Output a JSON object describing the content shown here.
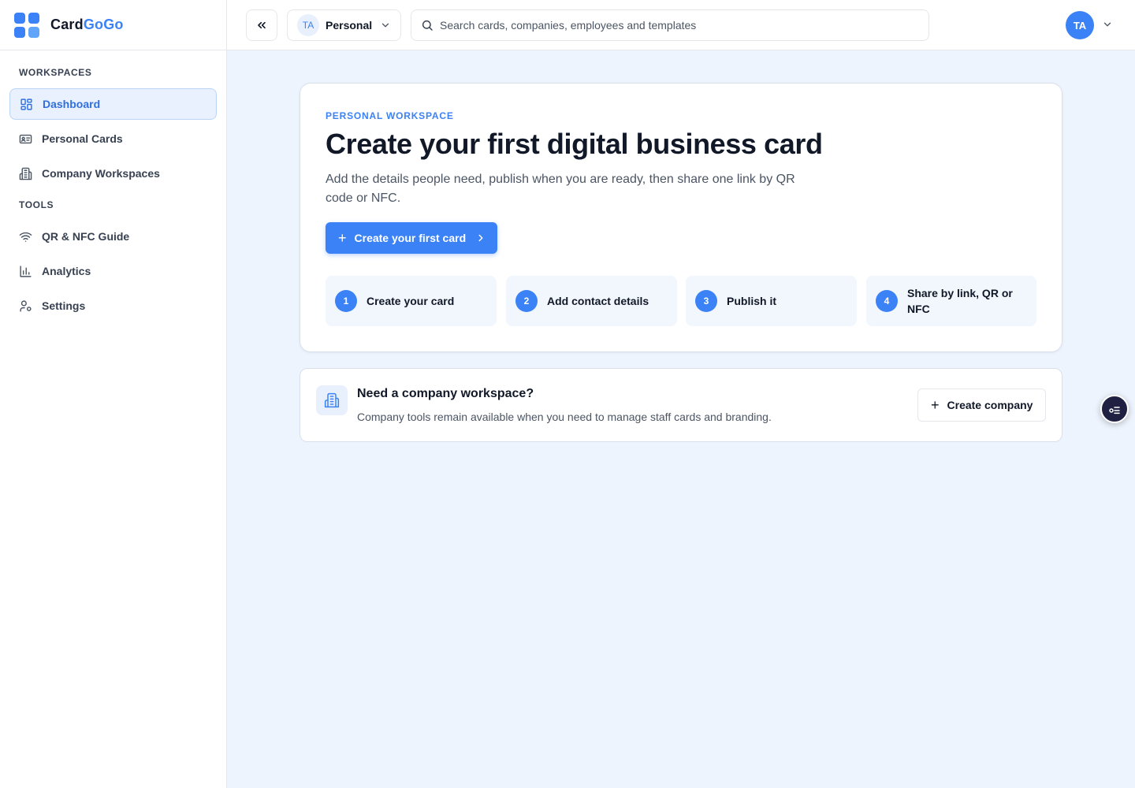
{
  "brand": {
    "name_part1": "Card",
    "name_part2": "GoGo"
  },
  "sidebar": {
    "sections": [
      {
        "label": "WORKSPACES"
      },
      {
        "label": "TOOLS"
      }
    ],
    "items": [
      {
        "label": "Dashboard",
        "icon": "dashboard-icon",
        "active": true
      },
      {
        "label": "Personal Cards",
        "icon": "id-card-icon"
      },
      {
        "label": "Company Workspaces",
        "icon": "building-icon"
      },
      {
        "label": "QR & NFC Guide",
        "icon": "wifi-icon"
      },
      {
        "label": "Analytics",
        "icon": "bar-chart-icon"
      },
      {
        "label": "Settings",
        "icon": "user-cog-icon"
      }
    ]
  },
  "topbar": {
    "collapse_icon": "chevrons-left-icon",
    "workspace": {
      "initials": "TA",
      "name": "Personal"
    },
    "search": {
      "placeholder": "Search cards, companies, employees and templates",
      "value": ""
    },
    "user": {
      "initials": "TA"
    }
  },
  "hero": {
    "eyebrow": "PERSONAL WORKSPACE",
    "title": "Create your first digital business card",
    "description": "Add the details people need, publish when you are ready, then share one link by QR code or NFC.",
    "cta_label": "Create your first card",
    "steps": [
      {
        "num": "1",
        "label": "Create your card"
      },
      {
        "num": "2",
        "label": "Add contact details"
      },
      {
        "num": "3",
        "label": "Publish it"
      },
      {
        "num": "4",
        "label": "Share by link, QR or NFC"
      }
    ]
  },
  "company": {
    "title": "Need a company workspace?",
    "description": "Company tools remain available when you need to manage staff cards and branding.",
    "button_label": "Create company"
  },
  "colors": {
    "accent": "#3b82f6",
    "background": "#eef4fd",
    "active_nav_bg": "#e9f1fe",
    "fab_bg": "#1f2042"
  }
}
